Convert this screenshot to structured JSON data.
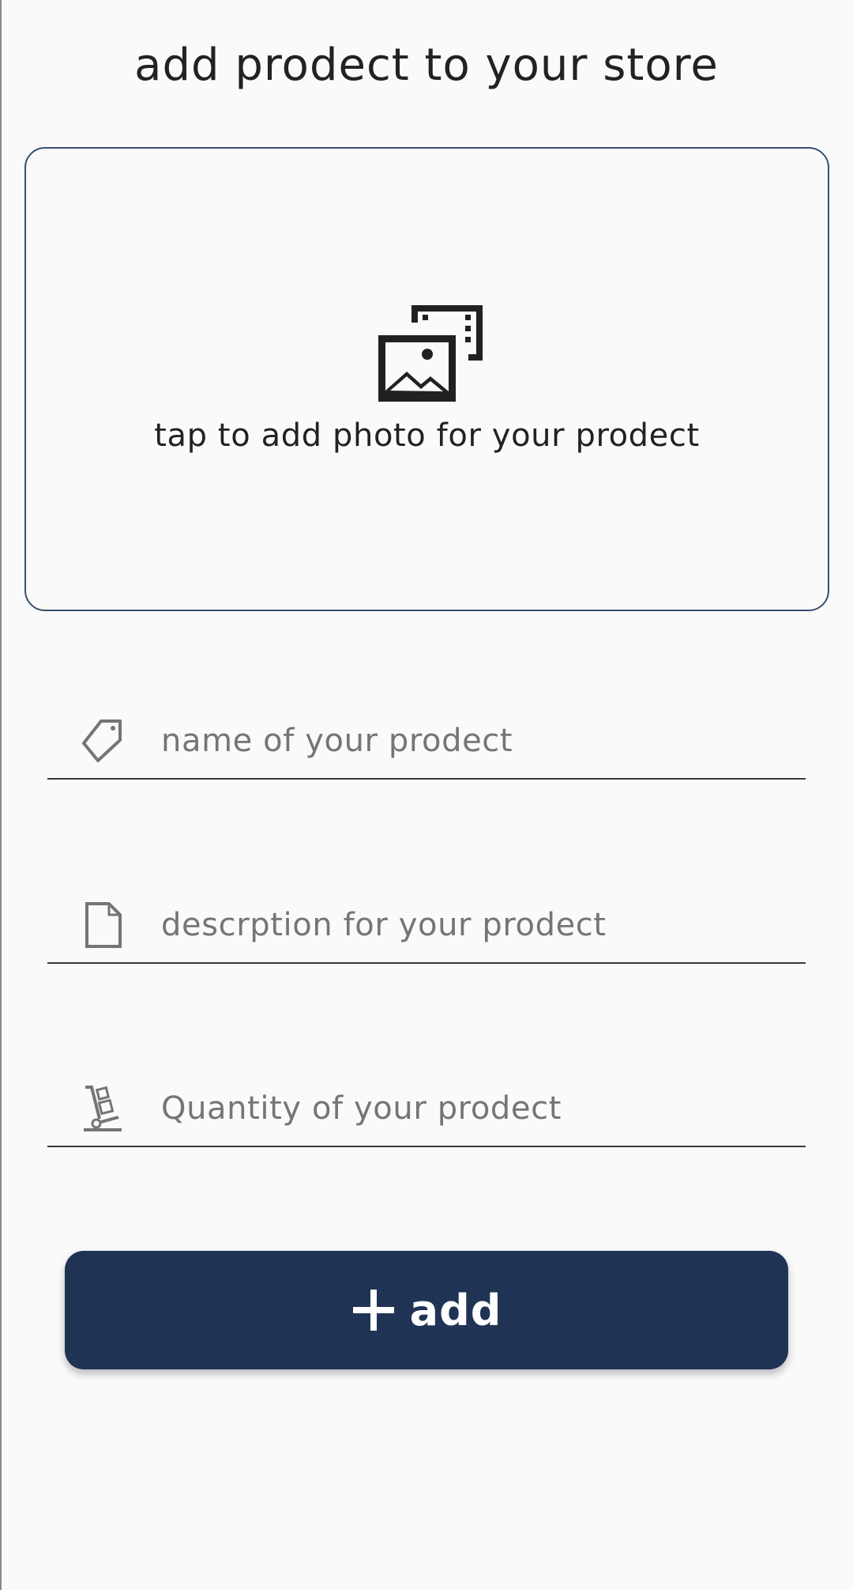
{
  "header": {
    "title": "add prodect to your store"
  },
  "photo_picker": {
    "icon": "photo-library-icon",
    "label": "tap to add photo for your prodect"
  },
  "form": {
    "fields": [
      {
        "icon": "tag-icon",
        "placeholder": "name of your prodect",
        "value": ""
      },
      {
        "icon": "document-icon",
        "placeholder": "descrption for your prodect",
        "value": ""
      },
      {
        "icon": "hand-truck-icon",
        "placeholder": "Quantity of your prodect",
        "value": ""
      }
    ]
  },
  "actions": {
    "add_icon": "plus-icon",
    "add_label": "add"
  },
  "colors": {
    "background": "#fafafa",
    "primary": "#1f3454",
    "border": "#36506e",
    "placeholder_text": "#757575"
  }
}
